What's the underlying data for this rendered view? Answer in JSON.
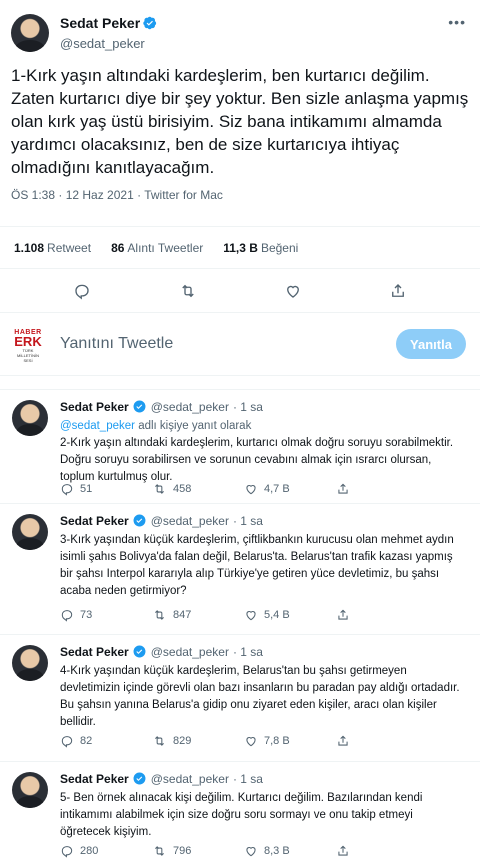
{
  "main_tweet": {
    "name": "Sedat Peker",
    "handle": "@sedat_peker",
    "text": "1-Kırk yaşın altındaki kardeşlerim, ben kurtarıcı değilim. Zaten kurtarıcı diye bir şey yoktur. Ben sizle anlaşma yapmış olan kırk yaş üstü birisiyim. Siz bana intikamımı almamda yardımcı olacaksınız, ben de size kurtarıcıya ihtiyaç olmadığını kanıtlayacağım.",
    "meta": "ÖS 1:38 · 12 Haz 2021 · Twitter for Mac"
  },
  "stats": {
    "retweets_value": "1.108",
    "retweets_label": "Retweet",
    "quotes_value": "86",
    "quotes_label": "Alıntı Tweetler",
    "likes_value": "11,3 B",
    "likes_label": "Beğeni"
  },
  "reply_box": {
    "logo_top": "HABER",
    "logo_main": "ERK",
    "logo_sub": "TÜRK MİLLETİNİN SESİ",
    "placeholder": "Yanıtını Tweetle",
    "button": "Yanıtla"
  },
  "replies": [
    {
      "name": "Sedat Peker",
      "handle": "@sedat_peker",
      "time": "· 1 sa",
      "replying_to": "@sedat_peker",
      "replying_suffix": "adlı kişiye yanıt olarak",
      "text": "2-Kırk yaşın altındaki kardeşlerim, kurtarıcı olmak doğru soruyu sorabilmektir. Doğru soruyu sorabilirsen ve sorunun cevabını almak için ısrarcı olursan, toplum kurtulmuş olur.",
      "replies": "51",
      "retweets": "458",
      "likes": "4,7 B"
    },
    {
      "name": "Sedat Peker",
      "handle": "@sedat_peker",
      "time": "· 1 sa",
      "text": "3-Kırk yaşından küçük kardeşlerim, çiftlikbankın kurucusu olan mehmet aydın isimli şahıs Bolivya'da falan değil, Belarus'ta. Belarus'tan trafik kazası yapmış bir şahsı Interpol kararıyla alıp Türkiye'ye getiren yüce devletimiz, bu şahsı acaba neden getirmiyor?",
      "replies": "73",
      "retweets": "847",
      "likes": "5,4 B"
    },
    {
      "name": "Sedat Peker",
      "handle": "@sedat_peker",
      "time": "· 1 sa",
      "text": "4-Kırk yaşından küçük kardeşlerim, Belarus'tan bu şahsı getirmeyen devletimizin içinde görevli olan bazı insanların bu paradan pay aldığı ortadadır. Bu şahsın yanına Belarus'a gidip onu ziyaret eden kişiler, aracı olan kişiler bellidir.",
      "replies": "82",
      "retweets": "829",
      "likes": "7,8 B"
    },
    {
      "name": "Sedat Peker",
      "handle": "@sedat_peker",
      "time": "· 1 sa",
      "text": "5- Ben örnek alınacak kişi değilim. Kurtarıcı değilim. Bazılarından kendi intikamımı alabilmek için size doğru soru sormayı ve onu takip etmeyi öğretecek kişiyim.",
      "replies": "280",
      "retweets": "796",
      "likes": "8,3 B"
    }
  ],
  "colors": {
    "accent": "#1d9bf0",
    "reply_button": "#8ecdf8",
    "muted": "#536471"
  }
}
